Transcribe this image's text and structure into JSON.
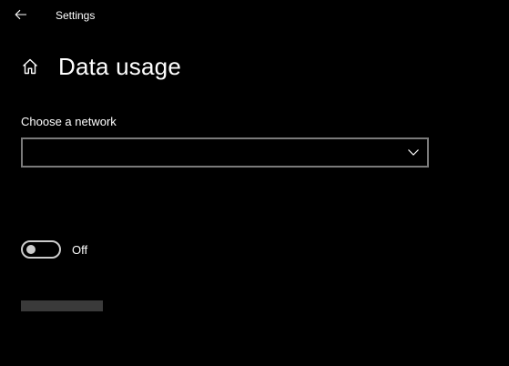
{
  "window": {
    "title": "Settings",
    "back_icon": "back-arrow-icon"
  },
  "page": {
    "title": "Data usage",
    "home_icon": "home-icon"
  },
  "network": {
    "label": "Choose a network",
    "selected": "",
    "chevron_icon": "chevron-down-icon"
  },
  "toggle": {
    "state_label": "Off",
    "on": false
  },
  "colors": {
    "background": "#000000",
    "text": "#ffffff",
    "border": "#7a7a7a",
    "placeholder": "#3a3a3a"
  }
}
